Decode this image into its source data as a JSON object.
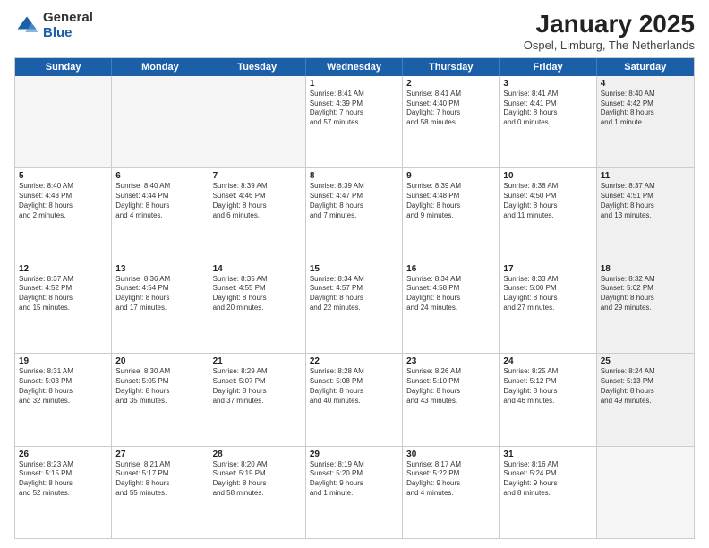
{
  "logo": {
    "general": "General",
    "blue": "Blue"
  },
  "header": {
    "title": "January 2025",
    "location": "Ospel, Limburg, The Netherlands"
  },
  "weekdays": [
    "Sunday",
    "Monday",
    "Tuesday",
    "Wednesday",
    "Thursday",
    "Friday",
    "Saturday"
  ],
  "weeks": [
    [
      {
        "day": "",
        "text": "",
        "empty": true
      },
      {
        "day": "",
        "text": "",
        "empty": true
      },
      {
        "day": "",
        "text": "",
        "empty": true
      },
      {
        "day": "1",
        "text": "Sunrise: 8:41 AM\nSunset: 4:39 PM\nDaylight: 7 hours\nand 57 minutes."
      },
      {
        "day": "2",
        "text": "Sunrise: 8:41 AM\nSunset: 4:40 PM\nDaylight: 7 hours\nand 58 minutes."
      },
      {
        "day": "3",
        "text": "Sunrise: 8:41 AM\nSunset: 4:41 PM\nDaylight: 8 hours\nand 0 minutes."
      },
      {
        "day": "4",
        "text": "Sunrise: 8:40 AM\nSunset: 4:42 PM\nDaylight: 8 hours\nand 1 minute.",
        "shaded": true
      }
    ],
    [
      {
        "day": "5",
        "text": "Sunrise: 8:40 AM\nSunset: 4:43 PM\nDaylight: 8 hours\nand 2 minutes."
      },
      {
        "day": "6",
        "text": "Sunrise: 8:40 AM\nSunset: 4:44 PM\nDaylight: 8 hours\nand 4 minutes."
      },
      {
        "day": "7",
        "text": "Sunrise: 8:39 AM\nSunset: 4:46 PM\nDaylight: 8 hours\nand 6 minutes."
      },
      {
        "day": "8",
        "text": "Sunrise: 8:39 AM\nSunset: 4:47 PM\nDaylight: 8 hours\nand 7 minutes."
      },
      {
        "day": "9",
        "text": "Sunrise: 8:39 AM\nSunset: 4:48 PM\nDaylight: 8 hours\nand 9 minutes."
      },
      {
        "day": "10",
        "text": "Sunrise: 8:38 AM\nSunset: 4:50 PM\nDaylight: 8 hours\nand 11 minutes."
      },
      {
        "day": "11",
        "text": "Sunrise: 8:37 AM\nSunset: 4:51 PM\nDaylight: 8 hours\nand 13 minutes.",
        "shaded": true
      }
    ],
    [
      {
        "day": "12",
        "text": "Sunrise: 8:37 AM\nSunset: 4:52 PM\nDaylight: 8 hours\nand 15 minutes."
      },
      {
        "day": "13",
        "text": "Sunrise: 8:36 AM\nSunset: 4:54 PM\nDaylight: 8 hours\nand 17 minutes."
      },
      {
        "day": "14",
        "text": "Sunrise: 8:35 AM\nSunset: 4:55 PM\nDaylight: 8 hours\nand 20 minutes."
      },
      {
        "day": "15",
        "text": "Sunrise: 8:34 AM\nSunset: 4:57 PM\nDaylight: 8 hours\nand 22 minutes."
      },
      {
        "day": "16",
        "text": "Sunrise: 8:34 AM\nSunset: 4:58 PM\nDaylight: 8 hours\nand 24 minutes."
      },
      {
        "day": "17",
        "text": "Sunrise: 8:33 AM\nSunset: 5:00 PM\nDaylight: 8 hours\nand 27 minutes."
      },
      {
        "day": "18",
        "text": "Sunrise: 8:32 AM\nSunset: 5:02 PM\nDaylight: 8 hours\nand 29 minutes.",
        "shaded": true
      }
    ],
    [
      {
        "day": "19",
        "text": "Sunrise: 8:31 AM\nSunset: 5:03 PM\nDaylight: 8 hours\nand 32 minutes."
      },
      {
        "day": "20",
        "text": "Sunrise: 8:30 AM\nSunset: 5:05 PM\nDaylight: 8 hours\nand 35 minutes."
      },
      {
        "day": "21",
        "text": "Sunrise: 8:29 AM\nSunset: 5:07 PM\nDaylight: 8 hours\nand 37 minutes."
      },
      {
        "day": "22",
        "text": "Sunrise: 8:28 AM\nSunset: 5:08 PM\nDaylight: 8 hours\nand 40 minutes."
      },
      {
        "day": "23",
        "text": "Sunrise: 8:26 AM\nSunset: 5:10 PM\nDaylight: 8 hours\nand 43 minutes."
      },
      {
        "day": "24",
        "text": "Sunrise: 8:25 AM\nSunset: 5:12 PM\nDaylight: 8 hours\nand 46 minutes."
      },
      {
        "day": "25",
        "text": "Sunrise: 8:24 AM\nSunset: 5:13 PM\nDaylight: 8 hours\nand 49 minutes.",
        "shaded": true
      }
    ],
    [
      {
        "day": "26",
        "text": "Sunrise: 8:23 AM\nSunset: 5:15 PM\nDaylight: 8 hours\nand 52 minutes."
      },
      {
        "day": "27",
        "text": "Sunrise: 8:21 AM\nSunset: 5:17 PM\nDaylight: 8 hours\nand 55 minutes."
      },
      {
        "day": "28",
        "text": "Sunrise: 8:20 AM\nSunset: 5:19 PM\nDaylight: 8 hours\nand 58 minutes."
      },
      {
        "day": "29",
        "text": "Sunrise: 8:19 AM\nSunset: 5:20 PM\nDaylight: 9 hours\nand 1 minute."
      },
      {
        "day": "30",
        "text": "Sunrise: 8:17 AM\nSunset: 5:22 PM\nDaylight: 9 hours\nand 4 minutes."
      },
      {
        "day": "31",
        "text": "Sunrise: 8:16 AM\nSunset: 5:24 PM\nDaylight: 9 hours\nand 8 minutes."
      },
      {
        "day": "",
        "text": "",
        "empty": true,
        "shaded": true
      }
    ]
  ]
}
